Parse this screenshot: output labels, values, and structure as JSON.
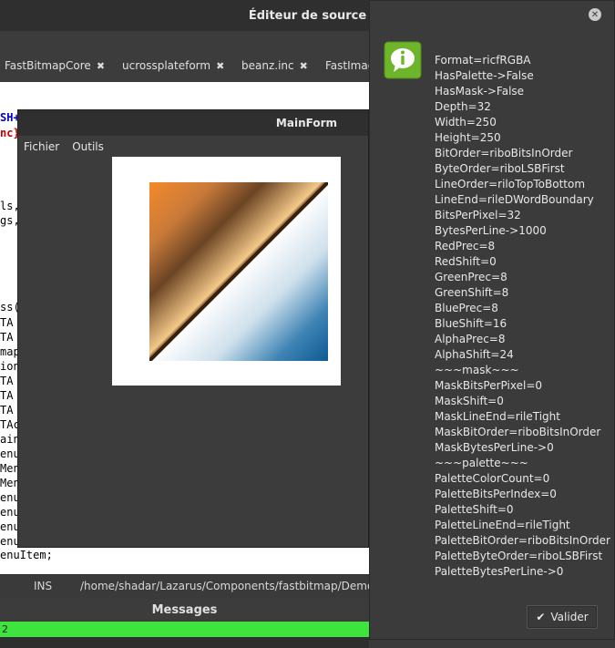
{
  "editor": {
    "title": "Éditeur de source",
    "tabs": [
      {
        "label": "FastBitmapCore"
      },
      {
        "label": "ucrossplateform"
      },
      {
        "label": "beanz.inc"
      },
      {
        "label": "FastImag"
      }
    ],
    "code_fragments": [
      "SH+",
      "nc}",
      "ls,",
      "gs,",
      "ss(",
      " TA",
      " TA",
      "map",
      "ion",
      " TA",
      " TA",
      " TA",
      "TAc",
      "ain",
      "enu",
      "Men",
      "Men",
      "enu",
      "enu",
      "enu",
      "enu",
      "enuItem;"
    ],
    "status": {
      "mode": "INS",
      "path": "/home/shadar/Lazarus/Components/fastbitmap/Demos/("
    },
    "messages_title": "Messages",
    "messages_line": "2"
  },
  "mainform": {
    "title": "MainForm",
    "menu": [
      "Fichier",
      "Outils"
    ]
  },
  "dialog": {
    "close_icon": "close-icon",
    "info_icon": "info-speech-icon",
    "lines": [
      "Format=ricfRGBA",
      "HasPalette->False",
      "HasMask->False",
      "Depth=32",
      "Width=250",
      "Height=250",
      "BitOrder=riboBitsInOrder",
      "ByteOrder=riboLSBFirst",
      "LineOrder=riloTopToBottom",
      "LineEnd=rileDWordBoundary",
      "BitsPerPixel=32",
      "BytesPerLine->1000",
      "RedPrec=8",
      "RedShift=0",
      "GreenPrec=8",
      "GreenShift=8",
      "BluePrec=8",
      "BlueShift=16",
      "AlphaPrec=8",
      "AlphaShift=24",
      "~~~mask~~~",
      "MaskBitsPerPixel=0",
      "MaskShift=0",
      "MaskLineEnd=rileTight",
      "MaskBitOrder=riboBitsInOrder",
      "MaskBytesPerLine->0",
      "~~~palette~~~",
      "PaletteColorCount=0",
      "PaletteBitsPerIndex=0",
      "PaletteShift=0",
      "PaletteLineEnd=rileTight",
      "PaletteBitOrder=riboBitsInOrder",
      "PaletteByteOrder=riboLSBFirst",
      "PaletteBytesPerLine->0"
    ],
    "validate_label": "Valider"
  },
  "colors": {
    "accent_green": "#3ee33e",
    "code_keyword": "#0000c8",
    "code_red": "#c80000"
  }
}
